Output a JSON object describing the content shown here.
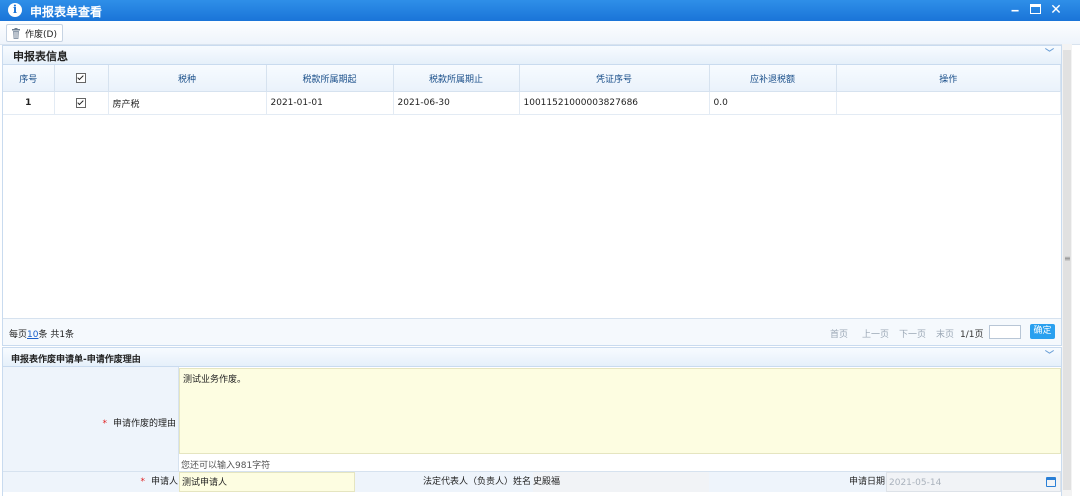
{
  "window": {
    "title": "申报表单查看"
  },
  "toolbar": {
    "void_label": "作废(D)"
  },
  "grid_section": {
    "title": "申报表信息",
    "columns": [
      "序号",
      "",
      "税种",
      "税款所属期起",
      "税款所属期止",
      "凭证序号",
      "应补退税额",
      "操作"
    ],
    "rows": [
      {
        "index": "1",
        "checked": true,
        "tax_type": "房产税",
        "period_start": "2021-01-01",
        "period_end": "2021-06-30",
        "voucher_no": "10011521000003827686",
        "amount": "0.0",
        "action": ""
      }
    ]
  },
  "pager": {
    "per_page_prefix": "每页",
    "per_page_value": "10",
    "per_page_suffix": "条 共1条",
    "first": "首页",
    "prev": "上一页",
    "next": "下一页",
    "last": "末页",
    "page_info": "1/1页",
    "go_label": "确定"
  },
  "form_section": {
    "title": "申报表作废申请单-申请作废理由",
    "reason_label": "申请作废的理由",
    "reason_value": "测试业务作废。",
    "counter": "您还可以输入981字符",
    "applicant_label": "申请人",
    "applicant_value": "测试申请人",
    "legal_rep_label": "法定代表人（负责人）姓名",
    "legal_rep_value": "史殿福",
    "date_label": "申请日期",
    "date_value": "2021-05-14"
  }
}
